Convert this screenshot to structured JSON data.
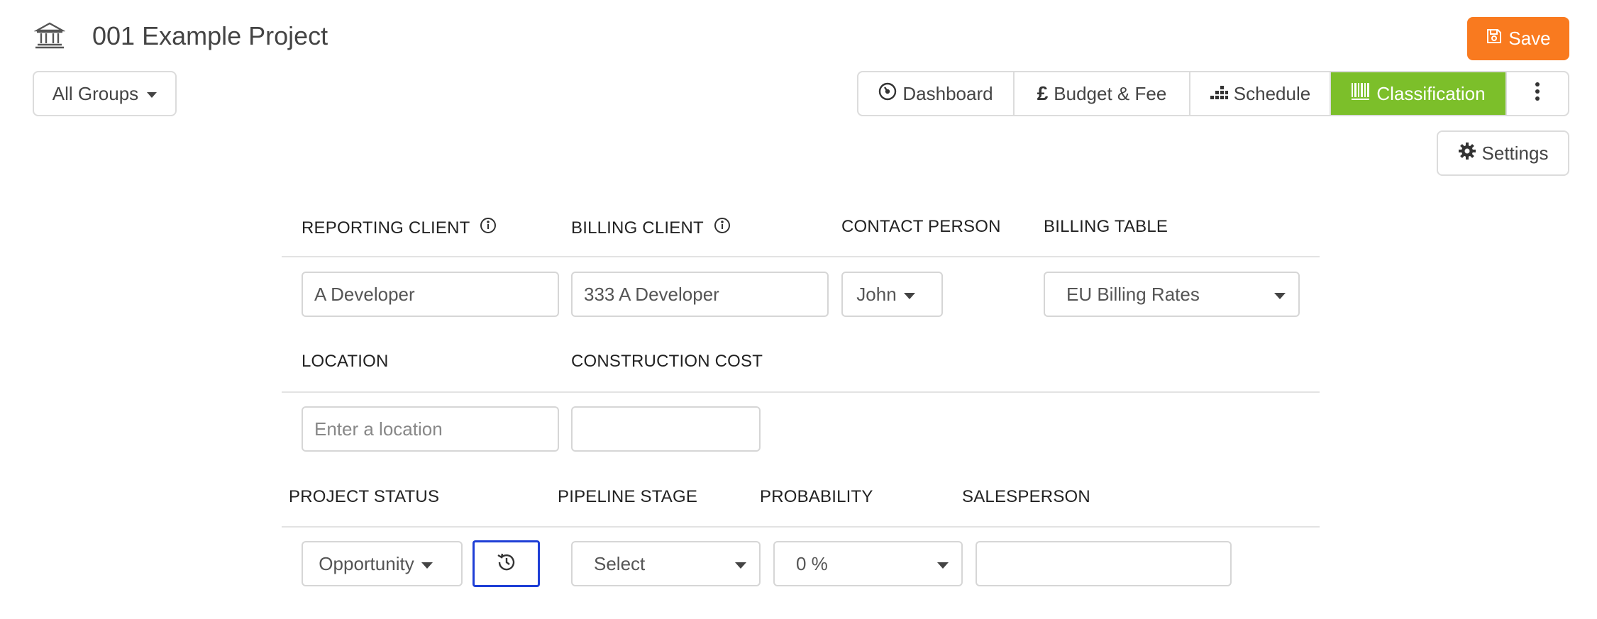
{
  "header": {
    "title": "001 Example Project",
    "project_icon": "bank-building-icon",
    "save_label": "Save",
    "save_icon": "floppy-disk-icon",
    "save_color": "#f97a1f"
  },
  "groups": {
    "label": "All Groups"
  },
  "nav": {
    "active_color": "#7cbf2a",
    "tabs": [
      {
        "label": "Dashboard",
        "icon": "gauge-icon"
      },
      {
        "label": "Budget & Fee",
        "icon": "pound-sign-icon"
      },
      {
        "label": "Schedule",
        "icon": "bar-chart-icon"
      },
      {
        "label": "Classification",
        "icon": "barcode-icon"
      }
    ],
    "more_icon": "vertical-ellipsis-icon"
  },
  "settings": {
    "label": "Settings",
    "icon": "gear-icon"
  },
  "form": {
    "reporting_client": {
      "label": "REPORTING CLIENT",
      "value": "A Developer"
    },
    "billing_client": {
      "label": "BILLING CLIENT",
      "value": "333 A Developer"
    },
    "contact_person": {
      "label": "CONTACT PERSON",
      "value": "John"
    },
    "billing_table": {
      "label": "BILLING TABLE",
      "value": "EU Billing Rates"
    },
    "location": {
      "label": "LOCATION",
      "placeholder": "Enter a location"
    },
    "construction_cost": {
      "label": "CONSTRUCTION COST",
      "value": ""
    },
    "project_status": {
      "label": "PROJECT STATUS",
      "value": "Opportunity",
      "history_icon": "history-icon"
    },
    "pipeline_stage": {
      "label": "PIPELINE STAGE",
      "value": "Select"
    },
    "probability": {
      "label": "PROBABILITY",
      "value": "0 %"
    },
    "salesperson": {
      "label": "SALESPERSON",
      "value": ""
    }
  }
}
